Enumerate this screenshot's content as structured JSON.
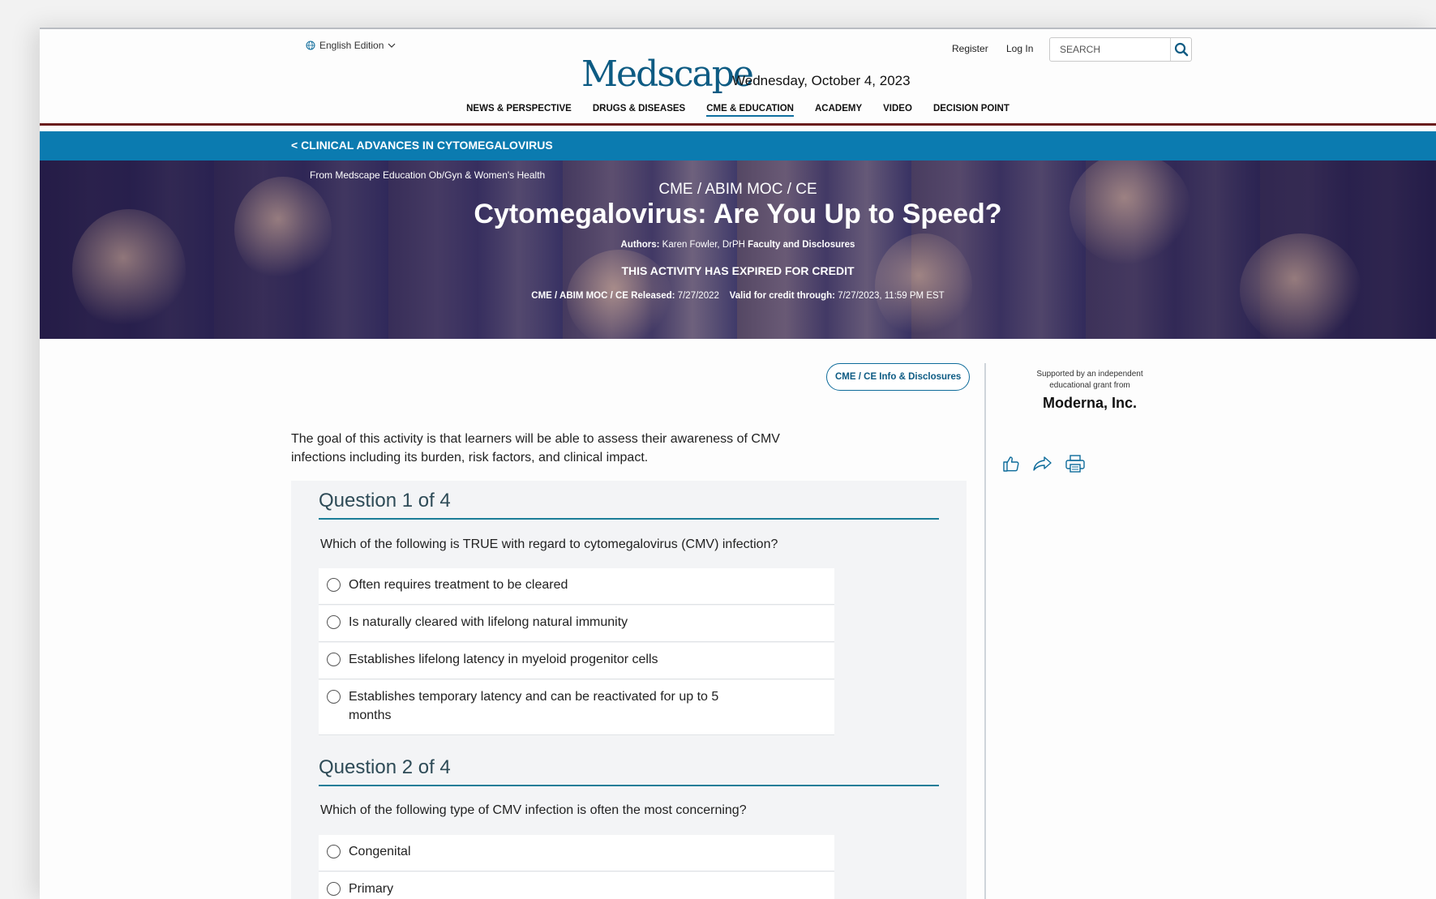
{
  "header": {
    "edition": "English Edition",
    "register": "Register",
    "login": "Log In",
    "search_placeholder": "SEARCH",
    "logo": "Medscape",
    "date": "Wednesday, October 4, 2023"
  },
  "nav": {
    "items": [
      "NEWS & PERSPECTIVE",
      "DRUGS & DISEASES",
      "CME & EDUCATION",
      "ACADEMY",
      "VIDEO",
      "DECISION POINT"
    ],
    "active_index": 2
  },
  "breadcrumb": "< CLINICAL ADVANCES IN CYTOMEGALOVIRUS",
  "hero": {
    "from": "From Medscape Education Ob/Gyn & Women's Health",
    "kicker": "CME / ABIM MOC / CE",
    "title": "Cytomegalovirus: Are You Up to Speed?",
    "authors_label": "Authors:",
    "authors": "Karen Fowler, DrPH",
    "faculty_link": "Faculty and Disclosures",
    "expired": "THIS ACTIVITY HAS EXPIRED FOR CREDIT",
    "released_label": "CME / ABIM MOC / CE Released:",
    "released": "7/27/2022",
    "valid_label": "Valid for credit through:",
    "valid": "7/27/2023, 11:59 PM EST"
  },
  "cme_button": "CME / CE Info & Disclosures",
  "sidebar": {
    "support_line1": "Supported by an independent",
    "support_line2": "educational grant from",
    "sponsor": "Moderna, Inc."
  },
  "goal": "The goal of this activity is that learners will be able to assess their awareness of CMV infections including its burden, risk factors, and clinical impact.",
  "questions": [
    {
      "title": "Question 1 of 4",
      "text": "Which of the following is TRUE with regard to cytomegalovirus (CMV) infection?",
      "options": [
        "Often requires treatment to be cleared",
        "Is naturally cleared with lifelong natural immunity",
        "Establishes lifelong latency in myeloid progenitor cells",
        "Establishes temporary latency and can be reactivated for up to 5 months"
      ]
    },
    {
      "title": "Question 2 of 4",
      "text": "Which of the following type of CMV infection is often the most concerning?",
      "options": [
        "Congenital",
        "Primary"
      ]
    }
  ],
  "colors": {
    "brand": "#0d5b83",
    "blue_bar": "#0b7bb0",
    "red_rule": "#6a1d1d",
    "hero_overlay": "#21194a",
    "question_rule": "#1b7d98"
  }
}
